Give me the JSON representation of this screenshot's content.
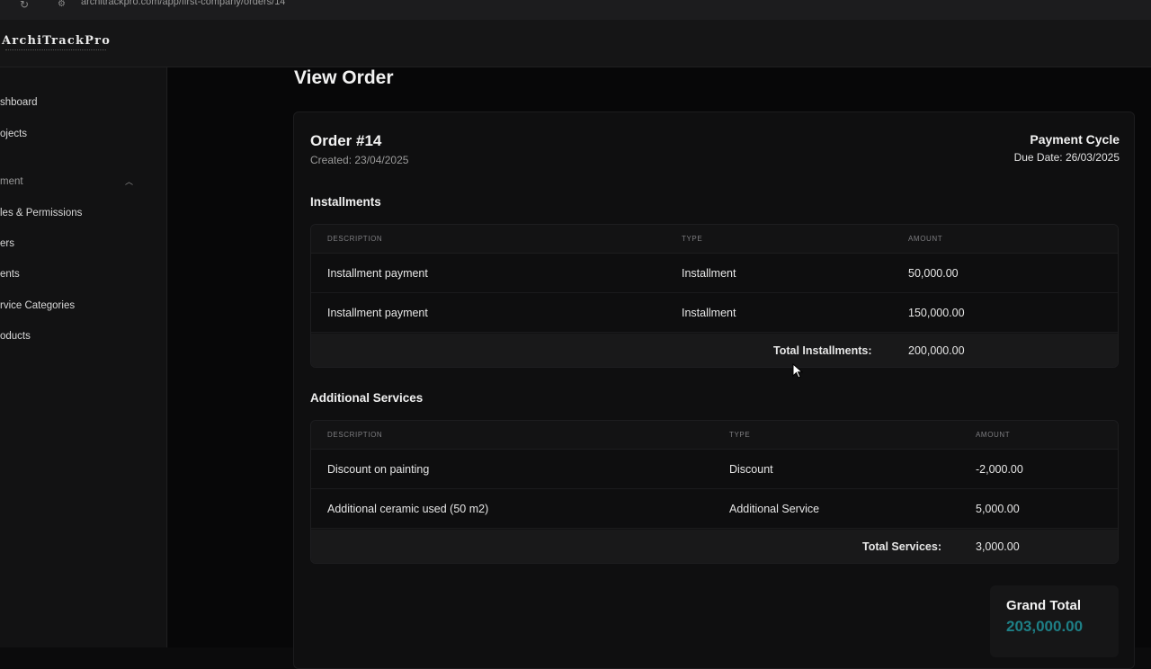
{
  "browser": {
    "url": "architrackpro.com/app/first-company/orders/14"
  },
  "app": {
    "logo": "ArchiTrackPro"
  },
  "sidebar": {
    "items": [
      {
        "label": "shboard"
      },
      {
        "label": "ojects"
      },
      {
        "label": "ment"
      },
      {
        "label": "les & Permissions"
      },
      {
        "label": "ers"
      },
      {
        "label": "ents"
      },
      {
        "label": "rvice Categories"
      },
      {
        "label": "oducts"
      }
    ]
  },
  "page": {
    "title": "View Order"
  },
  "order": {
    "title": "Order #14",
    "created": "Created: 23/04/2025",
    "cycle_title": "Payment Cycle",
    "due_date": "Due Date: 26/03/2025"
  },
  "installments": {
    "title": "Installments",
    "headers": [
      "DESCRIPTION",
      "TYPE",
      "AMOUNT"
    ],
    "rows": [
      {
        "description": "Installment payment",
        "type": "Installment",
        "amount": "50,000.00"
      },
      {
        "description": "Installment payment",
        "type": "Installment",
        "amount": "150,000.00"
      }
    ],
    "total_label": "Total Installments:",
    "total_value": "200,000.00"
  },
  "services": {
    "title": "Additional Services",
    "headers": [
      "DESCRIPTION",
      "TYPE",
      "AMOUNT"
    ],
    "rows": [
      {
        "description": "Discount on painting",
        "type": "Discount",
        "amount": "-2,000.00"
      },
      {
        "description": "Additional ceramic used (50 m2)",
        "type": "Additional Service",
        "amount": "5,000.00"
      }
    ],
    "total_label": "Total Services:",
    "total_value": "3,000.00"
  },
  "grand_total": {
    "label": "Grand Total",
    "value": "203,000.00"
  },
  "colors": {
    "accent": "#1e7f86",
    "background": "#070708",
    "surface": "#0f0f10"
  },
  "icons": {
    "reload": "reload-icon",
    "site_info": "site-info-icon",
    "chevron": "chevron-up-icon",
    "cursor": "mouse-pointer-icon"
  }
}
